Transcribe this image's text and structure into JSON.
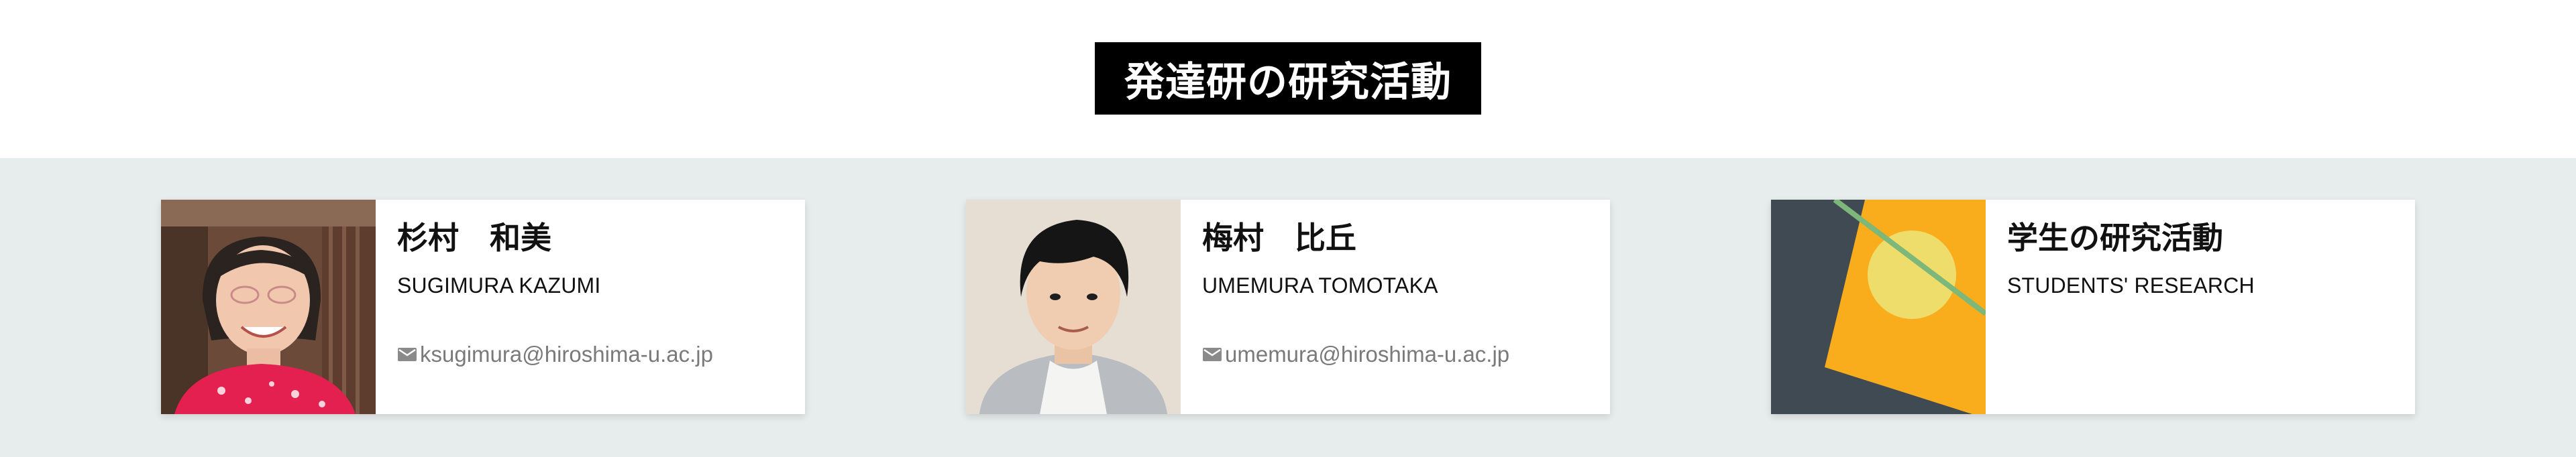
{
  "header": {
    "title": "発達研の研究活動"
  },
  "cards": [
    {
      "name_jp": "杉村　和美",
      "name_en": "SUGIMURA KAZUMI",
      "email": "ksugimura@hiroshima-u.ac.jp"
    },
    {
      "name_jp": "梅村　比丘",
      "name_en": "UMEMURA TOMOTAKA",
      "email": "umemura@hiroshima-u.ac.jp"
    },
    {
      "name_jp": "学生の研究活動",
      "name_en": "STUDENTS' RESEARCH"
    }
  ],
  "icons": {
    "email": "mail-icon"
  },
  "colors": {
    "title_bg": "#000000",
    "title_text": "#ffffff",
    "band_bg": "#e7ecec",
    "email_text": "#7a7a7a",
    "accent_yellow": "#f9ad1c",
    "accent_slate": "#3f4a52",
    "accent_green": "#7db87a"
  }
}
